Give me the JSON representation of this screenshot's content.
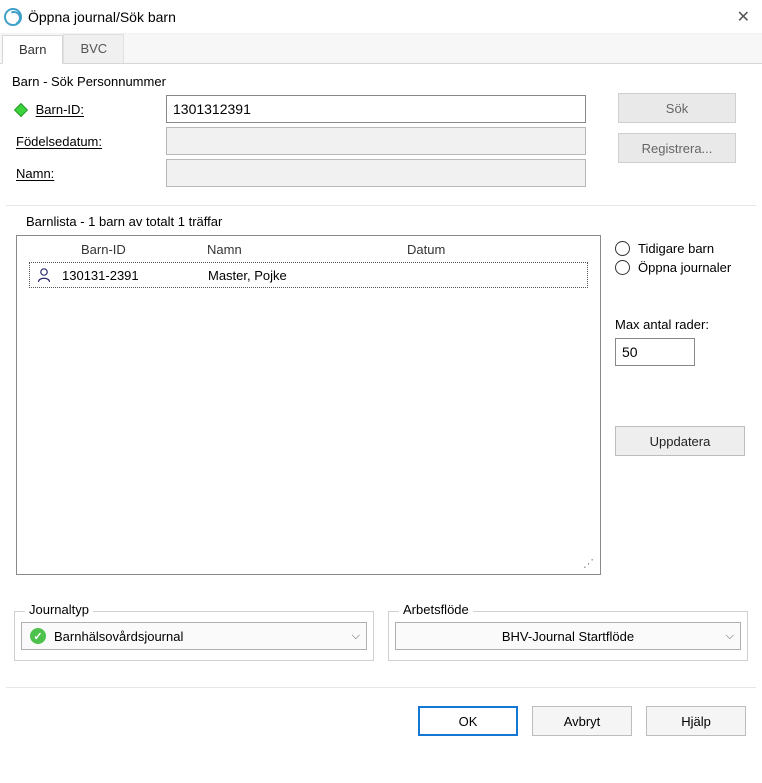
{
  "window": {
    "title": "Öppna journal/Sök barn"
  },
  "tabs": {
    "barn": "Barn",
    "bvc": "BVC"
  },
  "search": {
    "title": "Barn - Sök Personnummer",
    "labels": {
      "barn_id": "Barn-ID:",
      "fodelsedatum": "Födelsedatum:",
      "namn": "Namn:"
    },
    "values": {
      "barn_id": "1301312391",
      "fodelsedatum": "",
      "namn": ""
    },
    "buttons": {
      "sok": "Sök",
      "registrera": "Registrera..."
    }
  },
  "barnlista": {
    "title": "Barnlista - 1 barn av totalt 1 träffar",
    "columns": {
      "barn_id": "Barn-ID",
      "namn": "Namn",
      "datum": "Datum"
    },
    "rows": [
      {
        "barn_id": "130131-2391",
        "namn": "Master, Pojke",
        "datum": ""
      }
    ],
    "radios": {
      "tidigare": "Tidigare barn",
      "oppna": "Öppna journaler"
    },
    "max_label": "Max antal rader:",
    "max_value": "50",
    "uppdatera": "Uppdatera"
  },
  "bottom": {
    "journaltyp_label": "Journaltyp",
    "journaltyp_value": "Barnhälsovårdsjournal",
    "arbetsflode_label": "Arbetsflöde",
    "arbetsflode_value": "BHV-Journal Startflöde"
  },
  "dialog": {
    "ok": "OK",
    "avbryt": "Avbryt",
    "hjalp": "Hjälp"
  }
}
